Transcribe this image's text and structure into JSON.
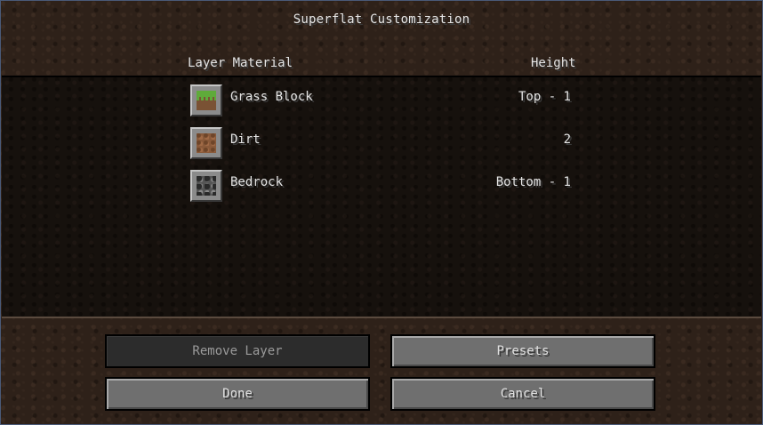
{
  "screen": {
    "title": "Superflat Customization"
  },
  "columns": {
    "material": "Layer Material",
    "height": "Height"
  },
  "layers": [
    {
      "name": "Grass Block",
      "height": "Top - 1",
      "icon": "grass-block-icon"
    },
    {
      "name": "Dirt",
      "height": "2",
      "icon": "dirt-icon"
    },
    {
      "name": "Bedrock",
      "height": "Bottom - 1",
      "icon": "bedrock-icon"
    }
  ],
  "buttons": {
    "remove_layer": "Remove Layer",
    "presets": "Presets",
    "done": "Done",
    "cancel": "Cancel"
  }
}
